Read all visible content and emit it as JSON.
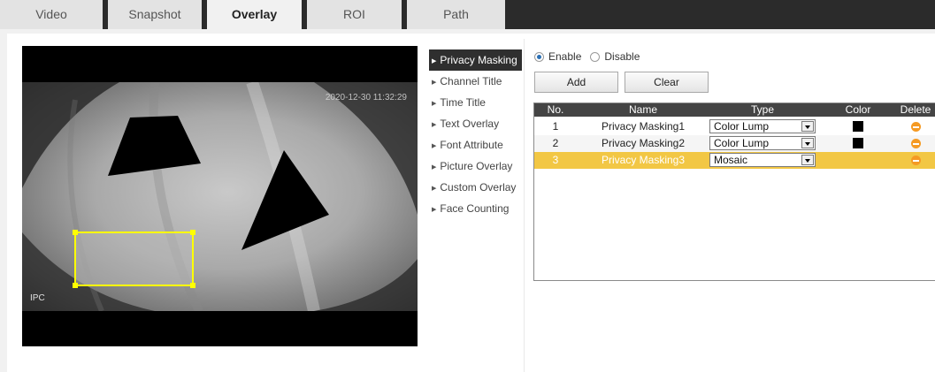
{
  "tabs": [
    {
      "label": "Video"
    },
    {
      "label": "Snapshot"
    },
    {
      "label": "Overlay"
    },
    {
      "label": "ROI"
    },
    {
      "label": "Path"
    }
  ],
  "preview": {
    "timestamp": "2020-12-30 11:32:29",
    "channel_title": "IPC"
  },
  "menu": {
    "items": [
      {
        "label": "Privacy Masking"
      },
      {
        "label": "Channel Title"
      },
      {
        "label": "Time Title"
      },
      {
        "label": "Text Overlay"
      },
      {
        "label": "Font Attribute"
      },
      {
        "label": "Picture Overlay"
      },
      {
        "label": "Custom Overlay"
      },
      {
        "label": "Face Counting"
      }
    ]
  },
  "mode": {
    "enable_label": "Enable",
    "disable_label": "Disable",
    "selected": "Enable"
  },
  "toolbar": {
    "add_label": "Add",
    "clear_label": "Clear"
  },
  "table": {
    "headers": {
      "no": "No.",
      "name": "Name",
      "type": "Type",
      "color": "Color",
      "delete": "Delete"
    },
    "rows": [
      {
        "no": "1",
        "name": "Privacy Masking1",
        "type": "Color Lump",
        "color": "#000000"
      },
      {
        "no": "2",
        "name": "Privacy Masking2",
        "type": "Color Lump",
        "color": "#000000"
      },
      {
        "no": "3",
        "name": "Privacy Masking3",
        "type": "Mosaic"
      }
    ]
  },
  "colors": {
    "selected_row": "#f2c744",
    "header_bg": "#444444",
    "active_menu": "#2f2f2f",
    "delete_icon": "#f59a23",
    "mask_region_outline": "#ffff00"
  }
}
